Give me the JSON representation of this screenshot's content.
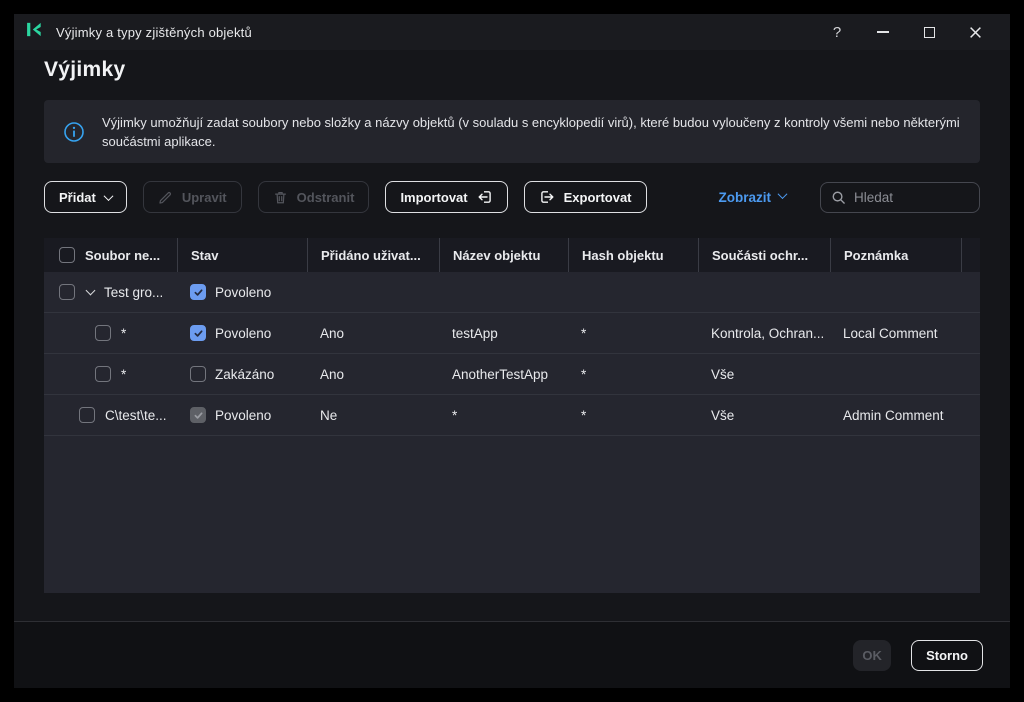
{
  "window": {
    "title": "Výjimky a typy zjištěných objektů",
    "controls": {
      "help": "?"
    }
  },
  "page": {
    "title": "Výjimky",
    "info_text": "Výjimky umožňují zadat soubory nebo složky a názvy objektů (v souladu s encyklopedií virů), které budou vyloučeny z kontroly všemi nebo některými součástmi aplikace."
  },
  "toolbar": {
    "add_label": "Přidat",
    "edit_label": "Upravit",
    "delete_label": "Odstranit",
    "import_label": "Importovat",
    "export_label": "Exportovat",
    "view_label": "Zobrazit",
    "search_placeholder": "Hledat"
  },
  "table": {
    "columns": [
      "Soubor ne...",
      "Stav",
      "Přidáno uživat...",
      "Název objektu",
      "Hash objektu",
      "Součásti ochr...",
      "Poznámka"
    ],
    "rows": [
      {
        "level": "group",
        "name": "Test gro...",
        "status_label": "Povoleno",
        "status_checked": true,
        "status_disabled": false
      },
      {
        "level": "child",
        "name": "*",
        "status_label": "Povoleno",
        "status_checked": true,
        "status_disabled": false,
        "added_by_user": "Ano",
        "object_name": "testApp",
        "object_hash": "*",
        "protection_components": "Kontrola, Ochran...",
        "comment": "Local Comment"
      },
      {
        "level": "child",
        "name": "*",
        "status_label": "Zakázáno",
        "status_checked": false,
        "status_disabled": false,
        "added_by_user": "Ano",
        "object_name": "AnotherTestApp",
        "object_hash": "*",
        "protection_components": "Vše",
        "comment": ""
      },
      {
        "level": "item",
        "name": "C\\test\\te...",
        "status_label": "Povoleno",
        "status_checked": true,
        "status_disabled": true,
        "added_by_user": "Ne",
        "object_name": "*",
        "object_hash": "*",
        "protection_components": "Vše",
        "comment": "Admin Comment"
      }
    ]
  },
  "footer": {
    "ok_label": "OK",
    "cancel_label": "Storno"
  },
  "colors": {
    "accent_blue": "#6C9CF0",
    "link_blue": "#4C9AF0",
    "info_blue": "#36A3F0",
    "brand_green": "#2BD6A0",
    "table_bg": "#25262F",
    "header_bg": "#191A21",
    "window_bg": "#15161A"
  }
}
